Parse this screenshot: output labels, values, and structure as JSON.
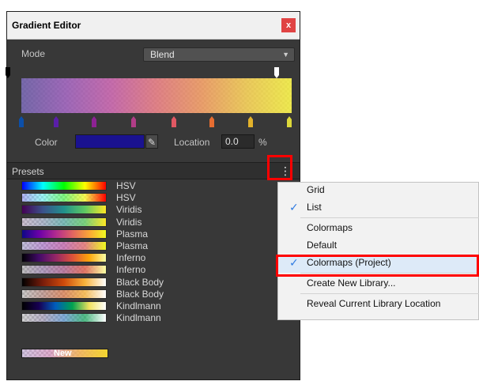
{
  "window": {
    "title": "Gradient Editor",
    "close_label": "x"
  },
  "mode": {
    "label": "Mode",
    "value": "Blend"
  },
  "gradient": {
    "colors": [
      "#5b4b9d",
      "#8f4bb0",
      "#c04fa0",
      "#e16a71",
      "#ee8f4f",
      "#f0c53c",
      "#f4ee2b"
    ],
    "markers_bottom": [
      "#0c4fa9",
      "#5a1ea8",
      "#8e2294",
      "#b13d87",
      "#e05863",
      "#e66d31",
      "#e3b22b",
      "#dcd83a"
    ]
  },
  "color_row": {
    "color_label": "Color",
    "color_hex": "#1a1290",
    "location_label": "Location",
    "location_value": "0.0",
    "percent": "%"
  },
  "presets": {
    "label": "Presets",
    "items": [
      {
        "label": "HSV",
        "style": "hsv-solid"
      },
      {
        "label": "HSV",
        "style": "hsv-checker"
      },
      {
        "label": "Viridis",
        "style": "viridis-solid"
      },
      {
        "label": "Viridis",
        "style": "viridis-checker"
      },
      {
        "label": "Plasma",
        "style": "plasma-solid"
      },
      {
        "label": "Plasma",
        "style": "plasma-checker"
      },
      {
        "label": "Inferno",
        "style": "inferno-solid"
      },
      {
        "label": "Inferno",
        "style": "inferno-checker"
      },
      {
        "label": "Black Body",
        "style": "blackbody-solid"
      },
      {
        "label": "Black Body",
        "style": "blackbody-checker"
      },
      {
        "label": "Kindlmann",
        "style": "kindlmann-solid"
      },
      {
        "label": "Kindlmann",
        "style": "kindlmann-checker"
      }
    ],
    "new_label": "New"
  },
  "menu": {
    "items": [
      {
        "label": "Grid",
        "checked": false
      },
      {
        "label": "List",
        "checked": true
      },
      {
        "label": "Colormaps",
        "checked": false
      },
      {
        "label": "Default",
        "checked": false
      },
      {
        "label": "Colormaps (Project)",
        "checked": true
      },
      {
        "label": "Create New Library...",
        "checked": false
      },
      {
        "label": "Reveal Current Library Location",
        "checked": false
      }
    ]
  }
}
